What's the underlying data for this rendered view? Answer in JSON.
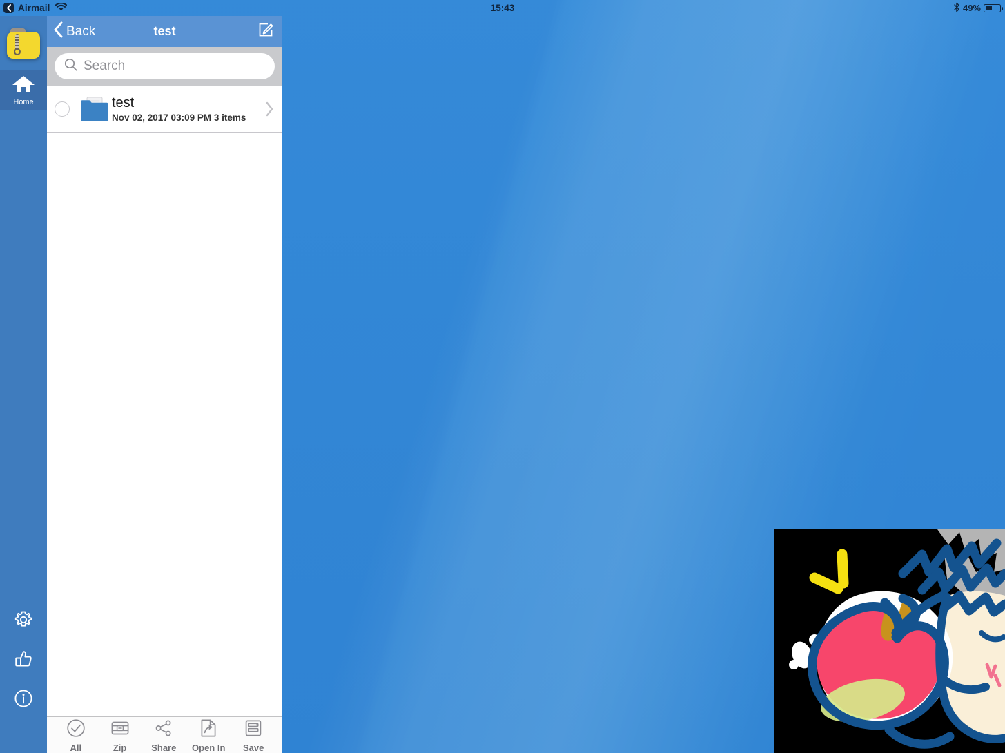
{
  "statusbar": {
    "back_app_label": "Airmail",
    "back_chip_icon": "chevron-left-icon",
    "wifi_icon": "wifi-icon",
    "clock": "15:43",
    "bluetooth_icon": "bluetooth-icon",
    "battery_percent": "49%",
    "battery_level": 49
  },
  "sidebar": {
    "app_icon": "zip-folder-app-icon",
    "items": [
      {
        "label": "Home",
        "icon": "home-icon",
        "selected": true
      }
    ],
    "bottom_items": [
      {
        "label": "Settings",
        "icon": "gear-icon"
      },
      {
        "label": "Rate",
        "icon": "thumbs-up-icon"
      },
      {
        "label": "Info",
        "icon": "info-circle-icon"
      }
    ]
  },
  "navbar": {
    "back_label": "Back",
    "back_icon": "chevron-left-icon",
    "title": "test",
    "compose_icon": "compose-icon"
  },
  "search": {
    "placeholder": "Search",
    "value": "",
    "icon": "search-icon"
  },
  "filelist": {
    "rows": [
      {
        "name": "test",
        "meta": "Nov 02, 2017 03:09 PM  3 items",
        "icon": "folder-icon",
        "checkbox_icon": "unchecked-circle-icon",
        "disclosure_icon": "chevron-right-icon",
        "selected": false
      }
    ]
  },
  "toolbar": {
    "items": [
      {
        "label": "All",
        "icon": "check-circle-icon"
      },
      {
        "label": "Zip",
        "icon": "zip-box-icon"
      },
      {
        "label": "Share",
        "icon": "share-icon"
      },
      {
        "label": "Open In",
        "icon": "open-in-icon"
      },
      {
        "label": "Save",
        "icon": "save-list-icon"
      }
    ]
  },
  "artwork": {
    "name": "anime-apple-illustration",
    "description": "Illustration of a large pink-red apple with yellow sparkles and a gray-haired character on a black background"
  },
  "colors": {
    "navbar_blue": "#5a93d4",
    "sidebar_blue": "#3f7cbe",
    "sidebar_selected": "#3a6daa",
    "search_bg": "#c9cacd",
    "folder_blue": "#3b82c4",
    "toolbar_gray": "#6d6d72",
    "wallpaper_blue": "#4a86c8",
    "app_icon_yellow": "#f3d82e"
  }
}
